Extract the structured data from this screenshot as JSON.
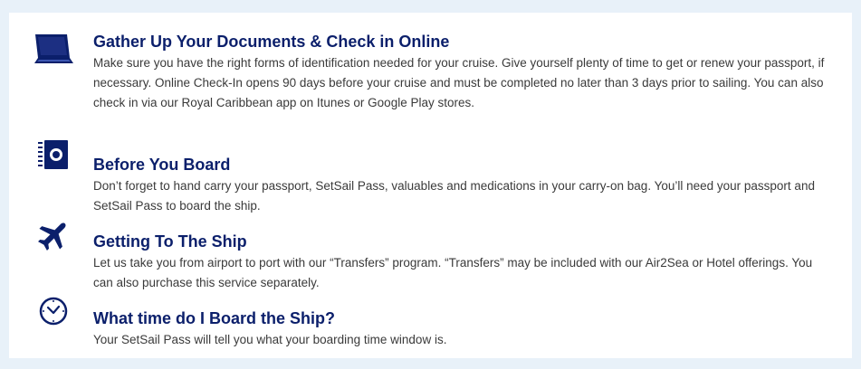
{
  "steps": [
    {
      "icon": "laptop-icon",
      "title": "Gather Up Your Documents & Check in Online",
      "text": "Make sure you have the right forms of identification needed for your cruise. Give yourself plenty of time to get or renew your passport, if necessary. Online Check-In opens 90 days before your cruise and must be completed no later than 3 days prior to sailing. You can also check in via our Royal Caribbean app on Itunes or Google Play stores."
    },
    {
      "icon": "passport-icon",
      "title": "Before You Board",
      "text": "Don’t forget to hand carry your passport, SetSail Pass, valuables and medications in your carry-on bag. You’ll need your passport and SetSail Pass to board the ship."
    },
    {
      "icon": "airplane-icon",
      "title": "Getting To The Ship",
      "text": "Let us take you from airport to port with our “Transfers” program. “Transfers” may be included with our Air2Sea or Hotel offerings. You can also purchase this service separately."
    },
    {
      "icon": "clock-icon",
      "title": "What time do I Board the Ship?",
      "text": "Your SetSail Pass will tell you what your boarding time window is."
    }
  ],
  "colors": {
    "background": "#e8f1f9",
    "panel": "#ffffff",
    "heading": "#0b1f6b",
    "body_text": "#3a3a3a",
    "icon": "#0b1f6b"
  }
}
